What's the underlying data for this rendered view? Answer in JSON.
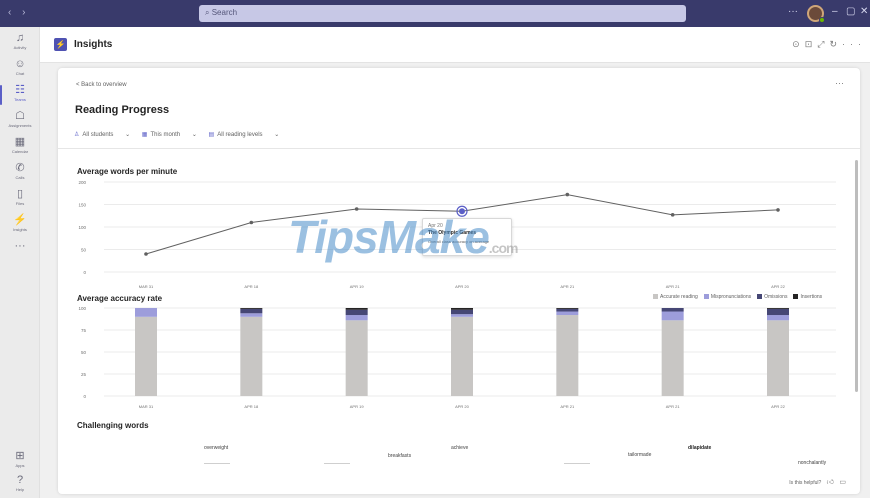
{
  "titlebar": {
    "search_placeholder": "Search",
    "more": "···",
    "win_min": "–",
    "win_max": "▢",
    "win_close": "✕"
  },
  "rail": {
    "items": [
      {
        "label": "Activity",
        "icon": "bell-icon",
        "glyph": "♫"
      },
      {
        "label": "Chat",
        "icon": "chat-icon",
        "glyph": "☺"
      },
      {
        "label": "Teams",
        "icon": "teams-icon",
        "glyph": "☷"
      },
      {
        "label": "Assignments",
        "icon": "assignments-icon",
        "glyph": "☖"
      },
      {
        "label": "Calendar",
        "icon": "calendar-icon",
        "glyph": "▦"
      },
      {
        "label": "Calls",
        "icon": "phone-icon",
        "glyph": "✆"
      },
      {
        "label": "Files",
        "icon": "file-icon",
        "glyph": "▯"
      },
      {
        "label": "Insights",
        "icon": "insights-icon",
        "glyph": "⚡"
      },
      {
        "label": "",
        "icon": "more-apps-icon",
        "glyph": "···"
      }
    ],
    "bottom": [
      {
        "label": "Apps",
        "icon": "apps-icon",
        "glyph": "⊞"
      },
      {
        "label": "Help",
        "icon": "help-icon",
        "glyph": "?"
      }
    ],
    "active_index": 2
  },
  "header": {
    "app_title": "Insights",
    "icons": [
      "refresh-icon",
      "open-icon",
      "expand-icon",
      "reload-icon",
      "more-icon"
    ]
  },
  "page": {
    "back_link": "< Back to overview",
    "title": "Reading Progress",
    "filters": [
      "All students",
      "This month",
      "All reading levels"
    ]
  },
  "wpm_chart": {
    "title": "Average words per minute"
  },
  "accuracy_chart": {
    "title": "Average accuracy rate",
    "legend": [
      {
        "label": "Accurate reading",
        "color": "#c8c6c4"
      },
      {
        "label": "Mispronunciations",
        "color": "#9d9ddb"
      },
      {
        "label": "Omissions",
        "color": "#464775"
      },
      {
        "label": "Insertions",
        "color": "#252424"
      }
    ]
  },
  "tooltip": {
    "date": "Apr 20",
    "title": "The Olympic Games",
    "note": "Overall class accuracy on average"
  },
  "challenging": {
    "title": "Challenging words",
    "words": [
      {
        "text": "overweight",
        "strong": false
      },
      {
        "text": "breakfasts",
        "strong": false
      },
      {
        "text": "achieve",
        "strong": false
      },
      {
        "text": "tailormade",
        "strong": false
      },
      {
        "text": "dilapidate",
        "strong": true
      },
      {
        "text": "nonchalantly",
        "strong": false
      }
    ]
  },
  "feedback": {
    "question": "Is this helpful?"
  },
  "watermark": {
    "brand": "TipsMake",
    "suffix": ".com"
  },
  "chart_data": [
    {
      "type": "line",
      "title": "Average words per minute",
      "x": [
        "MAR 31",
        "APR 18",
        "APR 19",
        "APR 20",
        "APR 21",
        "APR 21",
        "APR 22"
      ],
      "y_ticks": [
        0,
        50,
        100,
        150,
        200
      ],
      "ylim": [
        0,
        200
      ],
      "values": [
        40,
        110,
        140,
        135,
        172,
        127,
        138
      ],
      "highlight_index": 3,
      "color": "#616161",
      "highlight_color": "#5b5fc7"
    },
    {
      "type": "bar",
      "stacked": true,
      "title": "Average accuracy rate",
      "categories": [
        "MAR 31",
        "APR 18",
        "APR 19",
        "APR 20",
        "APR 21",
        "APR 21",
        "APR 22"
      ],
      "y_ticks": [
        0,
        25,
        50,
        75,
        100
      ],
      "ylim": [
        0,
        100
      ],
      "legend_position": "top-right",
      "series": [
        {
          "name": "Accurate reading",
          "color": "#c8c6c4",
          "values": [
            90,
            90,
            86,
            90,
            92,
            86,
            86
          ]
        },
        {
          "name": "Mispronunciations",
          "color": "#9d9ddb",
          "values": [
            10,
            4,
            6,
            3,
            4,
            10,
            6
          ]
        },
        {
          "name": "Omissions",
          "color": "#464775",
          "values": [
            0,
            5,
            6,
            5,
            3,
            4,
            7
          ]
        },
        {
          "name": "Insertions",
          "color": "#252424",
          "values": [
            0,
            1,
            2,
            2,
            1,
            0,
            1
          ]
        }
      ]
    }
  ]
}
